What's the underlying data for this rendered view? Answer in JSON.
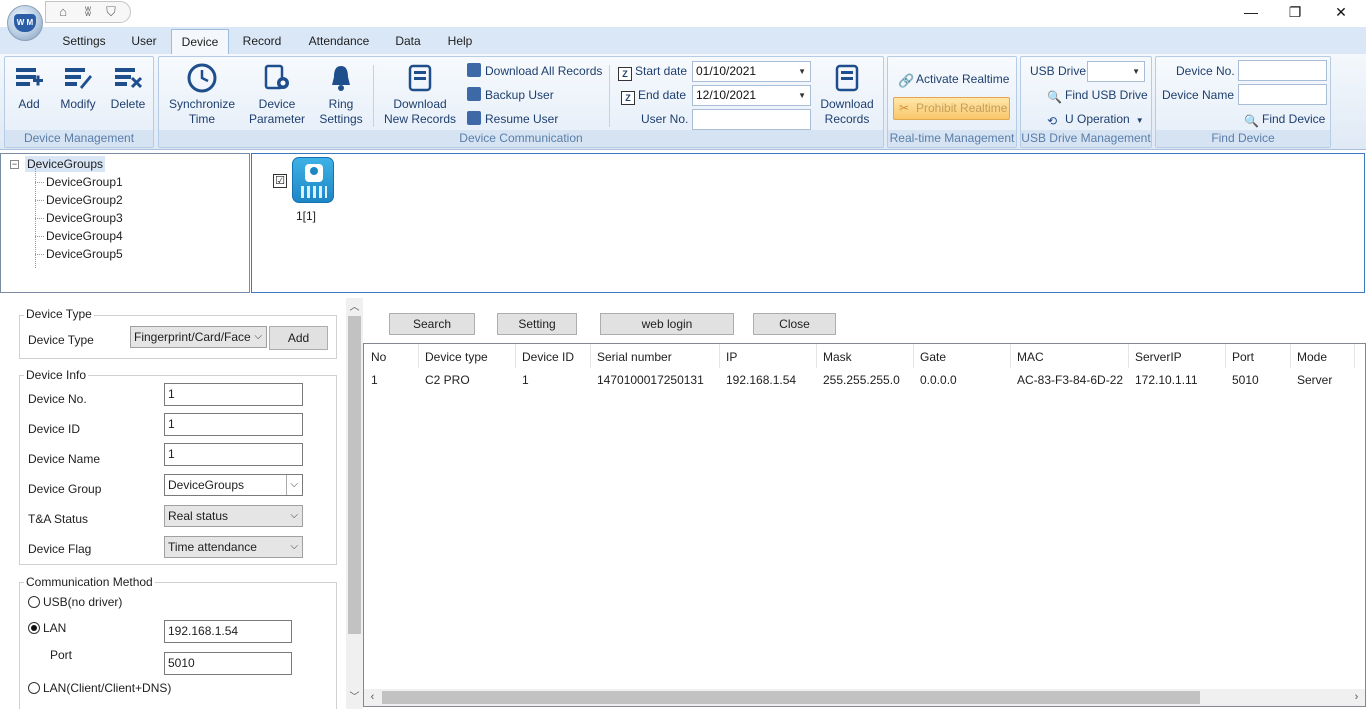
{
  "window": {
    "minimize": "—",
    "restore": "❐",
    "close": "✕"
  },
  "tabs": [
    "Settings",
    "User",
    "Device",
    "Record",
    "Attendance",
    "Data",
    "Help"
  ],
  "ribbon": {
    "device_management": {
      "label": "Device Management",
      "add": "Add",
      "modify": "Modify",
      "delete": "Delete"
    },
    "device_communication": {
      "label": "Device Communication",
      "sync_time": [
        "Synchronize",
        "Time"
      ],
      "device_parameter": [
        "Device",
        "Parameter"
      ],
      "ring_settings": [
        "Ring",
        "Settings"
      ],
      "download_new_records": [
        "Download",
        "New Records"
      ],
      "download_all_records": "Download All Records",
      "backup_user": "Backup User",
      "resume_user": "Resume User",
      "start_date_label": "Start date",
      "start_date": "01/10/2021",
      "end_date_label": "End date",
      "end_date": "12/10/2021",
      "user_no_label": "User No.",
      "user_no": "",
      "download_records": [
        "Download",
        "Records"
      ]
    },
    "realtime_management": {
      "label": "Real-time Management",
      "activate": "Activate Realtime",
      "prohibit": "Prohibit Realtime"
    },
    "usb_drive_management": {
      "label": "USB Drive Management",
      "usb_drive_label": "USB Drive",
      "usb_drive_value": "",
      "find_usb_drive": "Find USB Drive",
      "u_operation": "U Operation"
    },
    "find_device": {
      "label": "Find Device",
      "device_no_label": "Device No.",
      "device_no": "",
      "device_name_label": "Device Name",
      "device_name": "",
      "find_device": "Find Device"
    }
  },
  "tree": {
    "root": "DeviceGroups",
    "groups": [
      "DeviceGroup1",
      "DeviceGroup2",
      "DeviceGroup3",
      "DeviceGroup4",
      "DeviceGroup5"
    ]
  },
  "device_tile": {
    "label": "1[1]",
    "checked": "☑"
  },
  "form": {
    "device_type_section": "Device Type",
    "device_type_label": "Device Type",
    "device_type_value": "Fingerprint/Card/Face",
    "add_button": "Add",
    "device_info_section": "Device Info",
    "device_no_label": "Device No.",
    "device_no": "1",
    "device_id_label": "Device ID",
    "device_id": "1",
    "device_name_label": "Device Name",
    "device_name": "1",
    "device_group_label": "Device Group",
    "device_group": "DeviceGroups",
    "ta_status_label": "T&A Status",
    "ta_status": "Real status",
    "device_flag_label": "Device Flag",
    "device_flag": "Time attendance",
    "comm_section": "Communication Method",
    "usb_option": "USB(no driver)",
    "lan_option": "LAN",
    "lan_ip": "192.168.1.54",
    "port_label": "Port",
    "port": "5010",
    "lan_client_option": "LAN(Client/Client+DNS)"
  },
  "search_panel": {
    "search": "Search",
    "setting": "Setting",
    "web_login": "web login",
    "close": "Close"
  },
  "grid": {
    "columns": [
      "No",
      "Device type",
      "Device ID",
      "Serial number",
      "IP",
      "Mask",
      "Gate",
      "MAC",
      "ServerIP",
      "Port",
      "Mode"
    ],
    "rows": [
      [
        "1",
        "C2 PRO",
        "1",
        "1470100017250131",
        "192.168.1.54",
        "255.255.255.0",
        "0.0.0.0",
        "AC-83-F3-84-6D-22",
        "172.10.1.11",
        "5010",
        "Server"
      ]
    ]
  },
  "colors": {
    "ribbon_bg": "#dfe9f5",
    "tab_row": "#dae7f6",
    "accent_blue": "#3a7ac1",
    "group_label": "#5a7ea8"
  }
}
